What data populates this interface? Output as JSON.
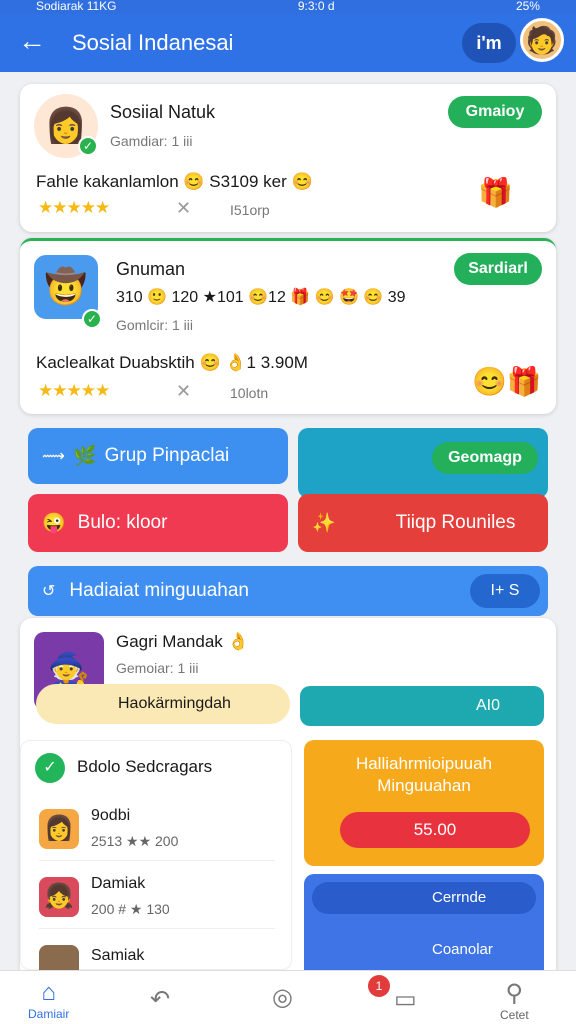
{
  "status": {
    "left": "Sodiarak 11KG",
    "time": "9:3:0 d",
    "right": "25%"
  },
  "header": {
    "title": "Sosial Indanesai",
    "pill": "i'm"
  },
  "cards": [
    {
      "name": "Sosiial Natuk",
      "sub": "Gamdiar: 1 iii",
      "button": "Gmaioy",
      "line": "Fahle kakanlamlon 😊 S3109 ker 😊",
      "stars": "★★★★★",
      "meta": "I51orp"
    },
    {
      "name": "Gnuman",
      "stats": "310 🙂 120 ★101 😊12 🎁 😊 🤩 😊 39",
      "sub": "Gomlcir: 1 iii",
      "button": "Sardiarl",
      "line": "Kaclealkat Duabsktih 😊 👌1 3.90M",
      "stars": "★★★★★",
      "meta": "10lotn"
    }
  ],
  "tiles": {
    "grup": "Grup Pinpaclai",
    "geomagp": "Geomagp",
    "bulor": "Bulo: kloor",
    "tiiqp": "Tiiqp Rouniles",
    "hadiah": "Hadiaiat minguuahan",
    "hadiah_btn": "I+ S"
  },
  "profile": {
    "name": "Gagri Mandak 👌",
    "sub": "Gemoiar: 1 iii",
    "pill": "Haokärmingdah",
    "aio": "AI0"
  },
  "leaderboard": {
    "title": "Bdolo Sedcragars",
    "rows": [
      {
        "name": "9odbi",
        "score": "2513 ★★ 200"
      },
      {
        "name": "Damiak",
        "score": "200 # ★ 130"
      },
      {
        "name": "Samiak",
        "score": ""
      }
    ]
  },
  "rewards": {
    "title1": "Halliahrmioipuuah",
    "title2": "Minguuahan",
    "value": "55.00",
    "c1": "Cerrnde",
    "c2": "Coanolar"
  },
  "nav": {
    "home": "Damiair",
    "chat": "Cetet",
    "badge": "1"
  }
}
